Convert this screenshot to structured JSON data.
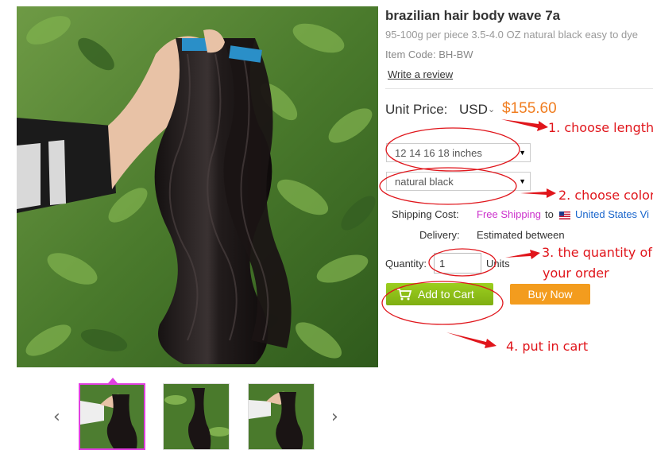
{
  "product": {
    "title": "brazilian hair body wave 7a",
    "subtitle": "95-100g per piece 3.5-4.0 OZ natural black easy to dye",
    "item_code": "Item Code: BH-BW",
    "write_review": "Write a review"
  },
  "price": {
    "label": "Unit Price:",
    "currency": "USD",
    "value": "$155.60",
    "value_color": "#f07d20"
  },
  "options": {
    "length_selected": "12 14 16 18 inches",
    "color_selected": "natural black"
  },
  "shipping": {
    "label": "Shipping Cost:",
    "free": "Free Shipping",
    "to": "to",
    "destination": "United States Vi",
    "flag_icon": "us-flag-icon"
  },
  "delivery": {
    "label": "Delivery:",
    "value": "Estimated between"
  },
  "quantity": {
    "label": "Quantity:",
    "value": "1",
    "units": "Units"
  },
  "buttons": {
    "add_to_cart": "Add to Cart",
    "buy_now": "Buy Now",
    "add_to_cart_color": "#8cbf18",
    "buy_now_color": "#f39c1e"
  },
  "annotations": {
    "step1": "1. choose length",
    "step2": "2. choose color",
    "step3_line1": "3. the quantity of",
    "step3_line2": "your order",
    "step4": "4. put in cart",
    "color": "#e0151b"
  },
  "gallery": {
    "thumbnail_count": 3,
    "selected_index": 0,
    "prev_icon": "chevron-left-icon",
    "next_icon": "chevron-right-icon"
  }
}
